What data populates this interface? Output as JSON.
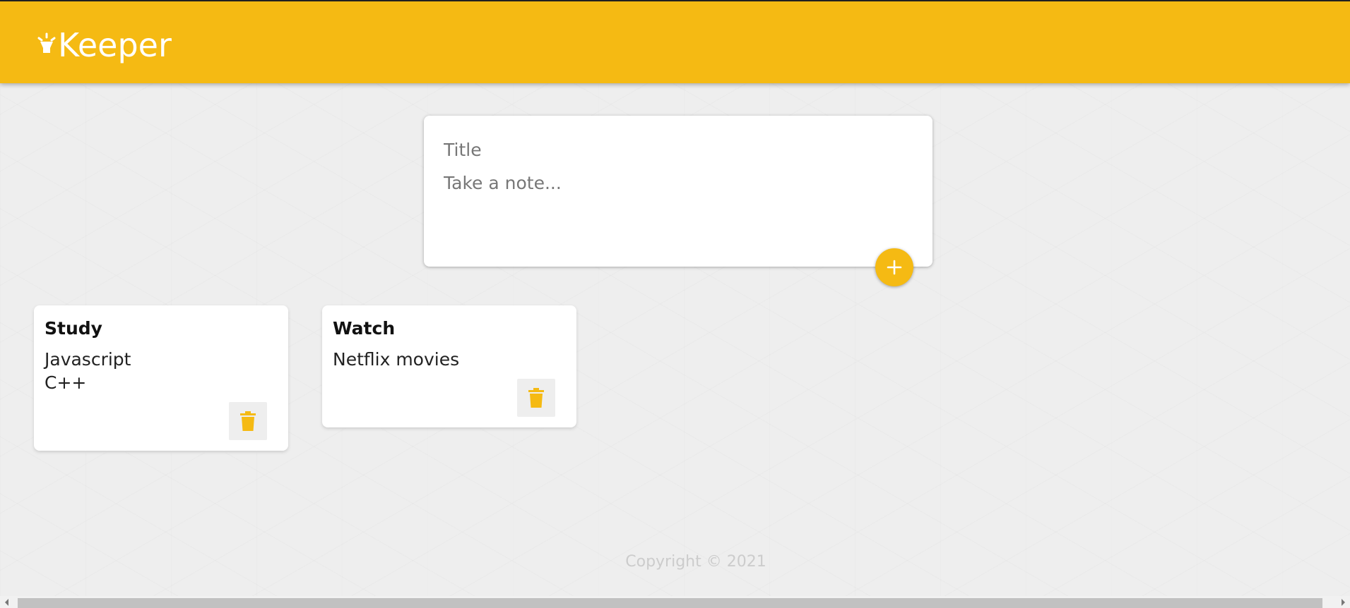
{
  "header": {
    "app_name": "Keeper",
    "logo_icon": "lightbulb-icon",
    "background_color": "#f5ba13"
  },
  "create_area": {
    "title_placeholder": "Title",
    "content_placeholder": "Take a note...",
    "add_icon": "plus-icon"
  },
  "notes": [
    {
      "title": "Study",
      "content": "Javascript\nC++",
      "delete_icon": "trash-icon"
    },
    {
      "title": "Watch",
      "content": "Netflix movies",
      "delete_icon": "trash-icon"
    }
  ],
  "footer": {
    "copyright": "Copyright © 2021"
  },
  "colors": {
    "accent": "#f5ba13",
    "background": "#eeeeee",
    "card": "#ffffff",
    "footer_text": "#cccccc"
  }
}
